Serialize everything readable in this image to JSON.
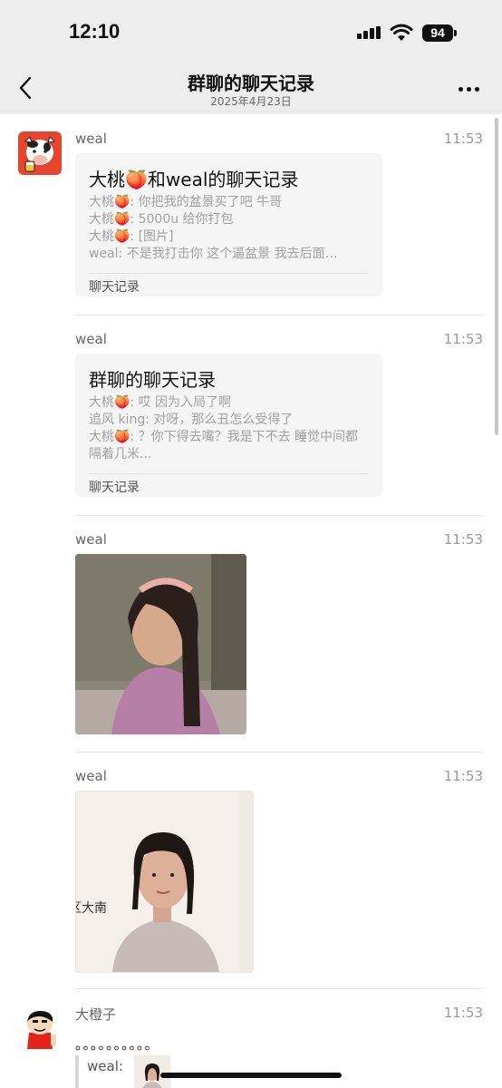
{
  "status_bar": {
    "time": "12:10",
    "battery": "94",
    "icons": [
      "signal-icon",
      "wifi-icon",
      "battery-icon"
    ]
  },
  "nav": {
    "title": "群聊的聊天记录",
    "subtitle": "2025年4月23日",
    "back_icon": "chevron-left-icon",
    "more_icon": "more-icon"
  },
  "messages": [
    {
      "sender": "weal",
      "time": "11:53",
      "type": "chat-record",
      "title": "大桃🍑和weal的聊天记录",
      "lines": [
        "大桃🍑: 你把我的盆景买了吧 牛哥",
        "大桃🍑: 5000u 给你打包",
        "大桃🍑: [图片]",
        "weal: 不是我打击你 这个逼盆景 我去后面…"
      ],
      "footer": "聊天记录"
    },
    {
      "sender": "weal",
      "time": "11:53",
      "type": "chat-record",
      "title": "群聊的聊天记录",
      "lines": [
        "大桃🍑: 哎 因为入局了啊",
        "追风 king: 对呀，那么丑怎么受得了",
        "大桃🍑: ？你下得去嘴？我是下不去 睡觉中间都隔着几米..."
      ],
      "footer": "聊天记录"
    },
    {
      "sender": "weal",
      "time": "11:53",
      "type": "image"
    },
    {
      "sender": "weal",
      "time": "11:53",
      "type": "image",
      "image_text": "区大南"
    },
    {
      "sender": "大橙子",
      "time": "11:53",
      "type": "text-with-quote",
      "text": "。。。。。。。。。。",
      "quote_sender": "weal:"
    }
  ],
  "colors": {
    "nav_background": "#ededed",
    "card_background": "#f5f5f5",
    "secondary_text": "#a0a0a0"
  }
}
